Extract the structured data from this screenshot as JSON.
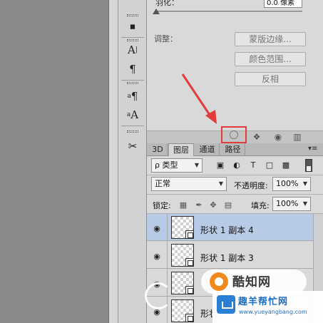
{
  "properties": {
    "feather_label": "羽化：",
    "feather_value": "0.0 像素",
    "adjust_label": "调整：",
    "buttons": [
      "蒙版边缘...",
      "颜色范围...",
      "反相"
    ]
  },
  "left_tools": {
    "icons": [
      "stamp-icon",
      "character-icon",
      "paragraph-icon",
      "paragraph-style-icon",
      "character-style-icon",
      "tools-icon"
    ]
  },
  "layers_panel": {
    "tabs": [
      "3D",
      "图层",
      "通道",
      "路径"
    ],
    "active_tab": "图层",
    "filter": {
      "kind_label": "ρ 类型"
    },
    "blend_mode": "正常",
    "opacity_label": "不透明度:",
    "opacity_value": "100%",
    "lock_label": "锁定:",
    "fill_label": "填充:",
    "fill_value": "100%",
    "layers": [
      {
        "name": "形状 1 副本 4",
        "selected": true
      },
      {
        "name": "形状 1 副本 3",
        "selected": false
      },
      {
        "name": "",
        "selected": false
      },
      {
        "name": "形状",
        "selected": false
      }
    ]
  },
  "watermark": {
    "brand": "酷知网",
    "site_name": "趣羊帮忙网",
    "site_url": "www.yueyangbang.com"
  },
  "colors": {
    "highlight": "#e23b3b",
    "arrow": "#e23b3b",
    "selected_row": "#b8cbe6"
  }
}
